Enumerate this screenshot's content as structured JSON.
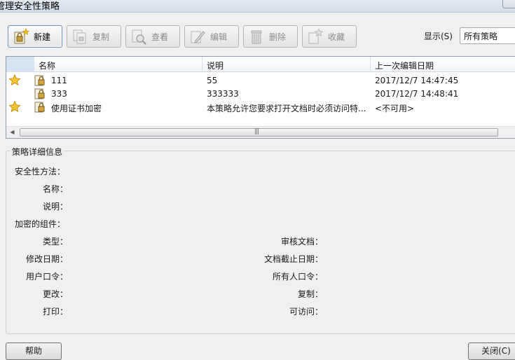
{
  "window": {
    "title": "管理安全性策略"
  },
  "toolbar": {
    "new_label": "新建",
    "copy_label": "复制",
    "view_label": "查看",
    "edit_label": "编辑",
    "delete_label": "删除",
    "favorite_label": "收藏",
    "show_label": "显示(S)",
    "show_value": "所有策略"
  },
  "table": {
    "columns": [
      "名称",
      "说明",
      "上一次编辑日期"
    ],
    "rows": [
      {
        "favorite": true,
        "name": "111",
        "description": "55",
        "last_edited": "2017/12/7 14:47:45"
      },
      {
        "favorite": false,
        "name": "333",
        "description": "333333",
        "last_edited": "2017/12/7 14:48:41"
      },
      {
        "favorite": true,
        "name": "使用证书加密",
        "description": "本策略允许您要求打开文档时必须访问特...",
        "last_edited": "<不可用>"
      }
    ]
  },
  "details": {
    "legend": "策略详细信息",
    "security_method": "安全性方法：",
    "name": "名称：",
    "description": "说明：",
    "encrypted_components": "加密的组件：",
    "type": "类型：",
    "modified_date": "修改日期：",
    "user_password": "用户口令：",
    "changes": "更改：",
    "print": "打印：",
    "review_docs": "审核文档：",
    "doc_expiry": "文档截止日期：",
    "owner_password": "所有人口令：",
    "copy": "复制：",
    "accessible": "可访问："
  },
  "footer": {
    "help_label": "帮助",
    "close_label": "关闭(C)"
  },
  "colors": {
    "star": "#f0c419",
    "accent": "#6b8fb8"
  }
}
